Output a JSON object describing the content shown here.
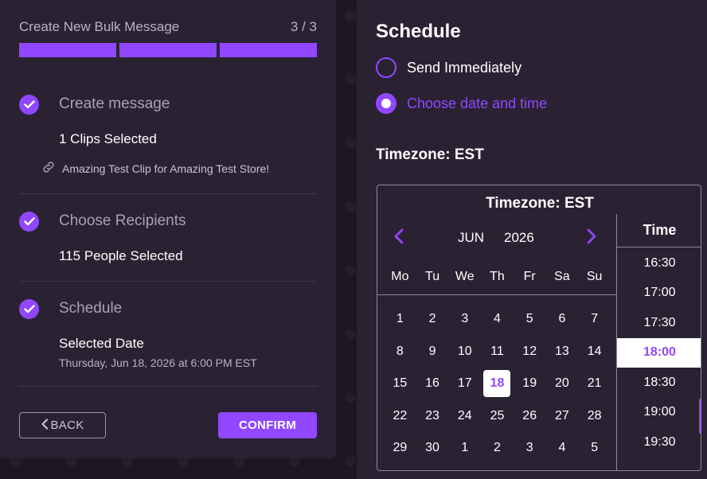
{
  "wizard": {
    "title": "Create New Bulk Message",
    "step_count": "3 / 3",
    "progress_fraction": 1.0
  },
  "steps": [
    {
      "title": "Create message",
      "line1": "1 Clips Selected",
      "link_text": "Amazing Test Clip for Amazing Test Store!"
    },
    {
      "title": "Choose Recipients",
      "line1": "115 People Selected"
    },
    {
      "title": "Schedule",
      "line1": "Selected Date",
      "line2": "Thursday, Jun 18, 2026 at 6:00 PM EST"
    }
  ],
  "buttons": {
    "back": "BACK",
    "confirm": "CONFIRM"
  },
  "schedule": {
    "title": "Schedule",
    "options": [
      {
        "label": "Send Immediately",
        "selected": false
      },
      {
        "label": "Choose date and time",
        "selected": true
      }
    ],
    "timezone_label": "Timezone: EST"
  },
  "picker": {
    "timezone": "Timezone: EST",
    "month": "JUN",
    "year": "2026",
    "weekdays": [
      "Mo",
      "Tu",
      "We",
      "Th",
      "Fr",
      "Sa",
      "Su"
    ],
    "days": [
      "1",
      "2",
      "3",
      "4",
      "5",
      "6",
      "7",
      "8",
      "9",
      "10",
      "11",
      "12",
      "13",
      "14",
      "15",
      "16",
      "17",
      "18",
      "19",
      "20",
      "21",
      "22",
      "23",
      "24",
      "25",
      "26",
      "27",
      "28",
      "29",
      "30",
      "1",
      "2",
      "3",
      "4",
      "5"
    ],
    "selected_day": "18",
    "time_header": "Time",
    "times": [
      "16:30",
      "17:00",
      "17:30",
      "18:00",
      "18:30",
      "19:00",
      "19:30"
    ],
    "selected_time": "18:00"
  },
  "colors": {
    "accent": "#9147ff",
    "panel": "#2a2232",
    "background": "#1c1622"
  }
}
